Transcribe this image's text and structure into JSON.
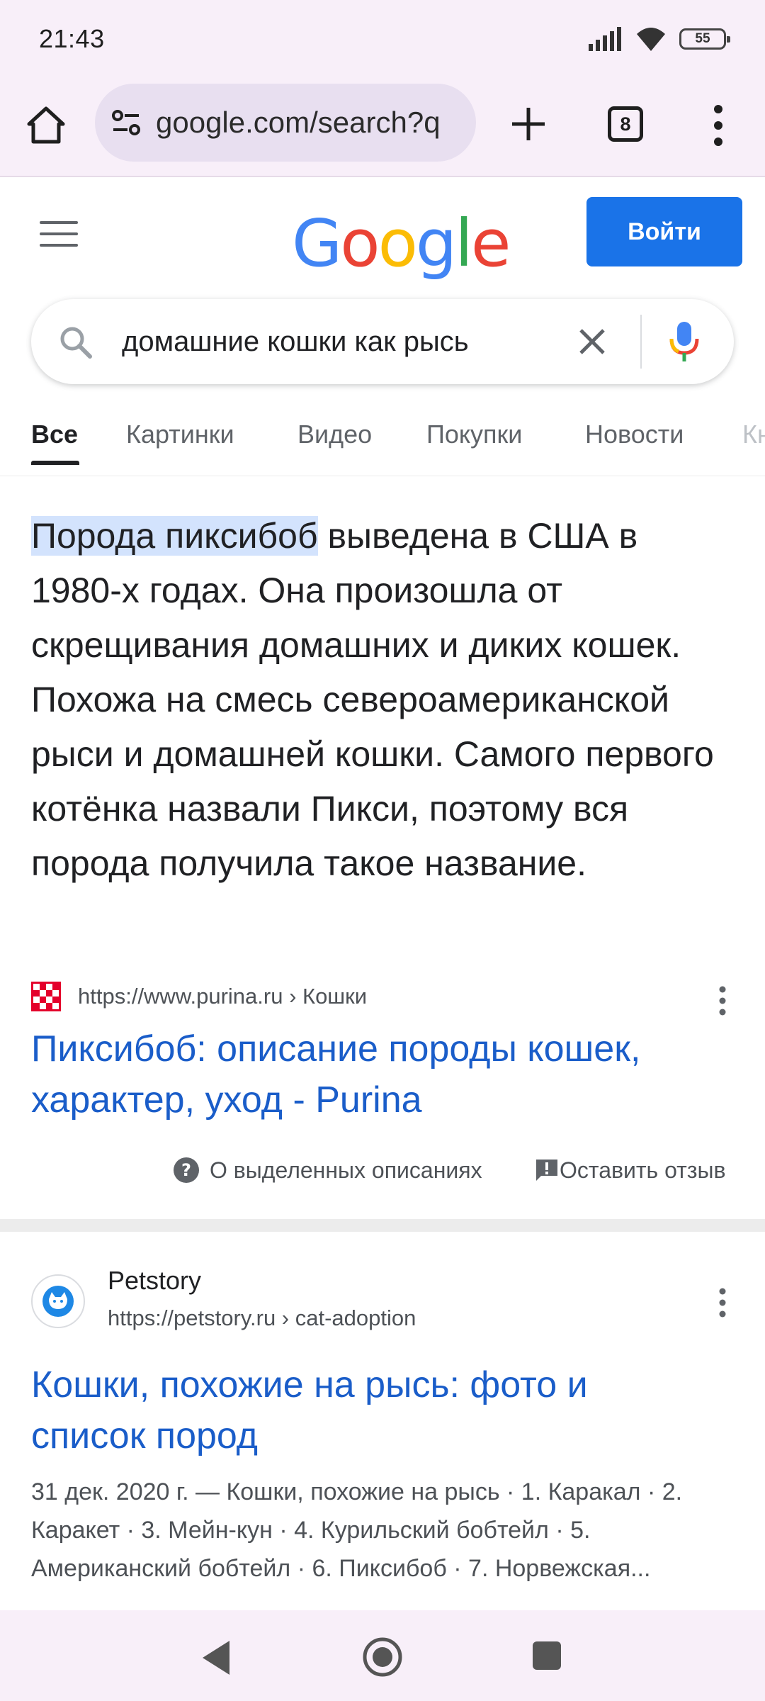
{
  "status_bar": {
    "time": "21:43",
    "battery": "55",
    "icons": [
      "signal-icon",
      "wifi-icon",
      "battery-icon"
    ]
  },
  "browser": {
    "url": "google.com/search?q",
    "tab_count": "8",
    "icons": [
      "home-icon",
      "site-settings-icon",
      "plus-icon",
      "tabs-icon",
      "overflow-menu-icon"
    ]
  },
  "google_header": {
    "logo": [
      "G",
      "o",
      "o",
      "g",
      "l",
      "e"
    ],
    "signin_label": "Войти"
  },
  "search": {
    "query": "домашние кошки как рысь"
  },
  "tabs": [
    {
      "label": "Все",
      "active": true
    },
    {
      "label": "Картинки",
      "active": false
    },
    {
      "label": "Видео",
      "active": false
    },
    {
      "label": "Покупки",
      "active": false
    },
    {
      "label": "Новости",
      "active": false
    },
    {
      "label": "Кн",
      "active": false
    }
  ],
  "featured_snippet": {
    "highlight": "Порода пиксибоб",
    "text": " выведена в США в 1980-х годах. Она произошла от скрещивания домашних и диких кошек. Похожа на смесь североамериканской рыси и домашней кошки. Самого первого котёнка назвали Пикси, поэтому вся порода получила такое название.",
    "source_url": "https://www.purina.ru › Кошки",
    "title_line1": "Пиксибоб: описание породы кошек,",
    "title_line2": "характер, уход - Purina",
    "about_label": "О выделенных описаниях",
    "feedback_label": "Оставить отзыв"
  },
  "result_2": {
    "site_name": "Petstory",
    "url": "https://petstory.ru › cat-adoption",
    "title_line1": "Кошки, похожие на рысь: фото и",
    "title_line2": "список пород",
    "description": "31 дек. 2020 г. — Кошки, похожие на рысь · 1. Каракал · 2. Каракет · 3. Мейн-кун · 4. Курильский бобтейл · 5. Американский бобтейл · 6. Пиксибоб · 7. Норвежская..."
  },
  "nav_bar": {
    "icons": [
      "back-icon",
      "home-circle-icon",
      "recents-icon"
    ]
  },
  "colors": {
    "link": "#1a5dc9",
    "accent": "#1a73e8",
    "chrome_bg": "#f8eff9",
    "highlight": "#d3e3fd"
  }
}
